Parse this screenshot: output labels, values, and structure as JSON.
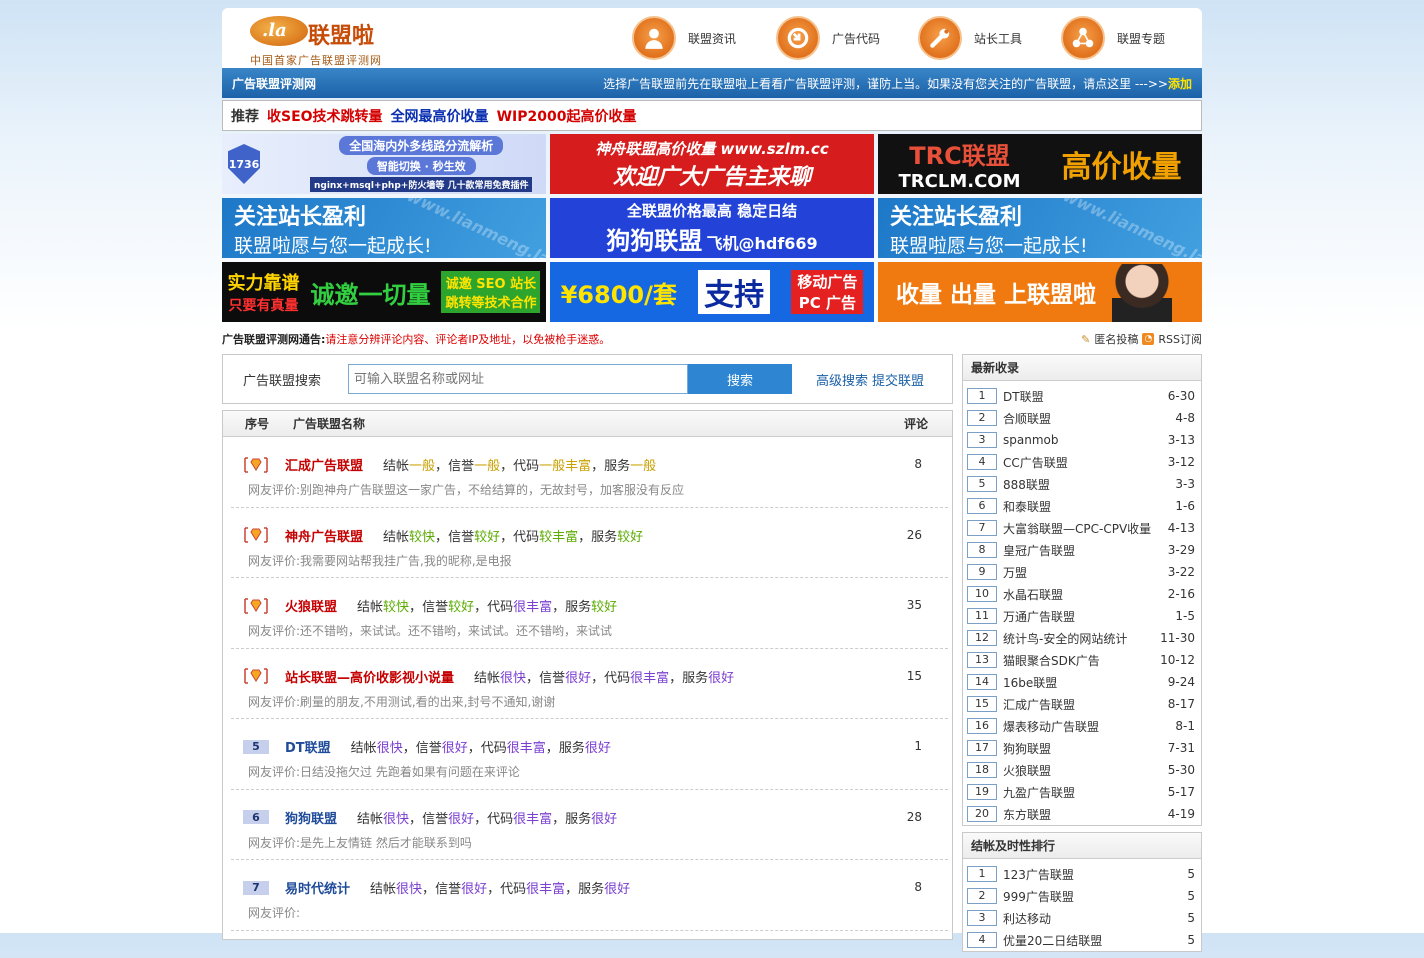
{
  "logo": {
    "mark": ".la",
    "name": "联盟啦",
    "slogan": "中国首家广告联盟评测网"
  },
  "nav": [
    {
      "label": "联盟资讯",
      "icon": "person-icon"
    },
    {
      "label": "广告代码",
      "icon": "code-icon"
    },
    {
      "label": "站长工具",
      "icon": "wrench-icon"
    },
    {
      "label": "联盟专题",
      "icon": "share-icon"
    }
  ],
  "bar": {
    "title": "广告联盟评测网",
    "tip": "选择广告联盟前先在联盟啦上看看广告联盟评测，谨防上当。如果没有您关注的广告联盟，请点这里 --->>",
    "add": "添加"
  },
  "recommend": {
    "label": "推荐",
    "links": [
      {
        "text": "收SEO技术跳转量",
        "color": "#d40000"
      },
      {
        "text": "全网最高价收量",
        "color": "#0a2fb0"
      },
      {
        "text": "WIP2000起高价收量",
        "color": "#d40000"
      }
    ]
  },
  "ads": [
    {
      "line1": "全国海内外多线路分流解析",
      "line2": "智能切换 · 秒生效",
      "line3": "nginx+msql+php+防火墙等  几十款常用免费插件",
      "badge": "1736"
    },
    {
      "line1": "神舟联盟高价收量 www.szlm.cc",
      "line2": "欢迎广大广告主来聊"
    },
    {
      "line1": "TRC联盟",
      "line2": "TRCLM.COM",
      "line3": "高价收量"
    },
    {
      "line1": "关注站长盈利",
      "line2": "联盟啦愿与您一起成长!",
      "wm": "www.lianmeng.la"
    },
    {
      "line1": "全联盟价格最高 稳定日结",
      "line2": "狗狗联盟",
      "line3": "飞机@hdf669"
    },
    {
      "line1": "关注站长盈利",
      "line2": "联盟啦愿与您一起成长!",
      "wm": "www.lianmeng.la"
    },
    {
      "line1": "实力靠谱",
      "line2": "只要有真量",
      "line3": "诚邀一切量",
      "line4": "诚邀 SEO 站长",
      "line5": "跳转等技术合作"
    },
    {
      "line1": "¥6800/套",
      "line2": "支持",
      "line3": "移动广告",
      "line4": "PC 广告"
    },
    {
      "line1": "收量 出量 上联盟啦"
    }
  ],
  "notice": {
    "label": "广告联盟评测网通告:",
    "text": "请注意分辨评论内容、评论者IP及地址，以免被枪手迷惑。",
    "submit": "匿名投稿",
    "rss": "RSS订阅"
  },
  "search": {
    "label": "广告联盟搜索",
    "placeholder": "可输入联盟名称或网址",
    "button": "搜索",
    "advanced": "高级搜索",
    "submit": "提交联盟"
  },
  "list": {
    "headers": {
      "no": "序号",
      "name": "广告联盟名称",
      "comments": "评论"
    },
    "rows": [
      {
        "rank": "",
        "name": "汇成广告联盟",
        "vip": true,
        "s": [
          [
            "结帐",
            "一般",
            "q"
          ],
          [
            "信誉",
            "一般",
            "q"
          ],
          [
            "代码",
            "一般丰富",
            "q"
          ],
          [
            "服务",
            "一般",
            "q"
          ]
        ],
        "review": "网友评价:别跑神舟广告联盟这一家广告，不给结算的，无故封号，加客服没有反应",
        "count": "8"
      },
      {
        "rank": "",
        "name": "神舟广告联盟",
        "vip": true,
        "s": [
          [
            "结帐",
            "较快",
            "g"
          ],
          [
            "信誉",
            "较好",
            "g"
          ],
          [
            "代码",
            "较丰富",
            "g"
          ],
          [
            "服务",
            "较好",
            "g"
          ]
        ],
        "review": "网友评价:我需要网站帮我挂广告,我的昵称,是电报",
        "count": "26"
      },
      {
        "rank": "",
        "name": "火狼联盟",
        "vip": true,
        "s": [
          [
            "结帐",
            "较快",
            "g"
          ],
          [
            "信誉",
            "较好",
            "g"
          ],
          [
            "代码",
            "很丰富",
            "p"
          ],
          [
            "服务",
            "较好",
            "g"
          ]
        ],
        "review": "网友评价:还不错哟，来试试。还不错哟，来试试。还不错哟，来试试",
        "count": "35"
      },
      {
        "rank": "",
        "name": "站长联盟—高价收影视小说量",
        "vip": true,
        "s": [
          [
            "结帐",
            "很快",
            "p"
          ],
          [
            "信誉",
            "很好",
            "p"
          ],
          [
            "代码",
            "很丰富",
            "p"
          ],
          [
            "服务",
            "很好",
            "p"
          ]
        ],
        "review": "网友评价:刷量的朋友,不用测试,看的出来,封号不通知,谢谢",
        "count": "15"
      },
      {
        "rank": "5",
        "name": "DT联盟",
        "vip": false,
        "s": [
          [
            "结帐",
            "很快",
            "p"
          ],
          [
            "信誉",
            "很好",
            "p"
          ],
          [
            "代码",
            "很丰富",
            "p"
          ],
          [
            "服务",
            "很好",
            "p"
          ]
        ],
        "review": "网友评价:日结没拖欠过 先跑着如果有问题在来评论",
        "count": "1"
      },
      {
        "rank": "6",
        "name": "狗狗联盟",
        "vip": false,
        "s": [
          [
            "结帐",
            "很快",
            "p"
          ],
          [
            "信誉",
            "很好",
            "p"
          ],
          [
            "代码",
            "很丰富",
            "p"
          ],
          [
            "服务",
            "很好",
            "p"
          ]
        ],
        "review": "网友评价:是先上友情链 然后才能联系到吗",
        "count": "28"
      },
      {
        "rank": "7",
        "name": "易时代统计",
        "vip": false,
        "s": [
          [
            "结帐",
            "很快",
            "p"
          ],
          [
            "信誉",
            "很好",
            "p"
          ],
          [
            "代码",
            "很丰富",
            "p"
          ],
          [
            "服务",
            "很好",
            "p"
          ]
        ],
        "review": "网友评价:",
        "count": "8"
      }
    ]
  },
  "latest": {
    "title": "最新收录",
    "items": [
      {
        "n": "1",
        "t": "DT联盟",
        "d": "6-30"
      },
      {
        "n": "2",
        "t": "合顺联盟",
        "d": "4-8"
      },
      {
        "n": "3",
        "t": "spanmob",
        "d": "3-13"
      },
      {
        "n": "4",
        "t": "CC广告联盟",
        "d": "3-12"
      },
      {
        "n": "5",
        "t": "888联盟",
        "d": "3-3"
      },
      {
        "n": "6",
        "t": "和泰联盟",
        "d": "1-6"
      },
      {
        "n": "7",
        "t": "大富翁联盟—CPC-CPV收量",
        "d": "4-13"
      },
      {
        "n": "8",
        "t": "皇冠广告联盟",
        "d": "3-29"
      },
      {
        "n": "9",
        "t": "万盟",
        "d": "3-22"
      },
      {
        "n": "10",
        "t": "水晶石联盟",
        "d": "2-16"
      },
      {
        "n": "11",
        "t": "万通广告联盟",
        "d": "1-5"
      },
      {
        "n": "12",
        "t": "统计鸟-安全的网站统计",
        "d": "11-30"
      },
      {
        "n": "13",
        "t": "猫眼聚合SDK广告",
        "d": "10-12"
      },
      {
        "n": "14",
        "t": "16be联盟",
        "d": "9-24"
      },
      {
        "n": "15",
        "t": "汇成广告联盟",
        "d": "8-17"
      },
      {
        "n": "16",
        "t": "爆表移动广告联盟",
        "d": "8-1"
      },
      {
        "n": "17",
        "t": "狗狗联盟",
        "d": "7-31"
      },
      {
        "n": "18",
        "t": "火狼联盟",
        "d": "5-30"
      },
      {
        "n": "19",
        "t": "九盈广告联盟",
        "d": "5-17"
      },
      {
        "n": "20",
        "t": "东方联盟",
        "d": "4-19"
      }
    ]
  },
  "payment": {
    "title": "结帐及时性排行",
    "items": [
      {
        "n": "1",
        "t": "123广告联盟",
        "d": "5"
      },
      {
        "n": "2",
        "t": "999广告联盟",
        "d": "5"
      },
      {
        "n": "3",
        "t": "利达移动",
        "d": "5"
      },
      {
        "n": "4",
        "t": "优量20二日结联盟",
        "d": "5"
      }
    ]
  }
}
